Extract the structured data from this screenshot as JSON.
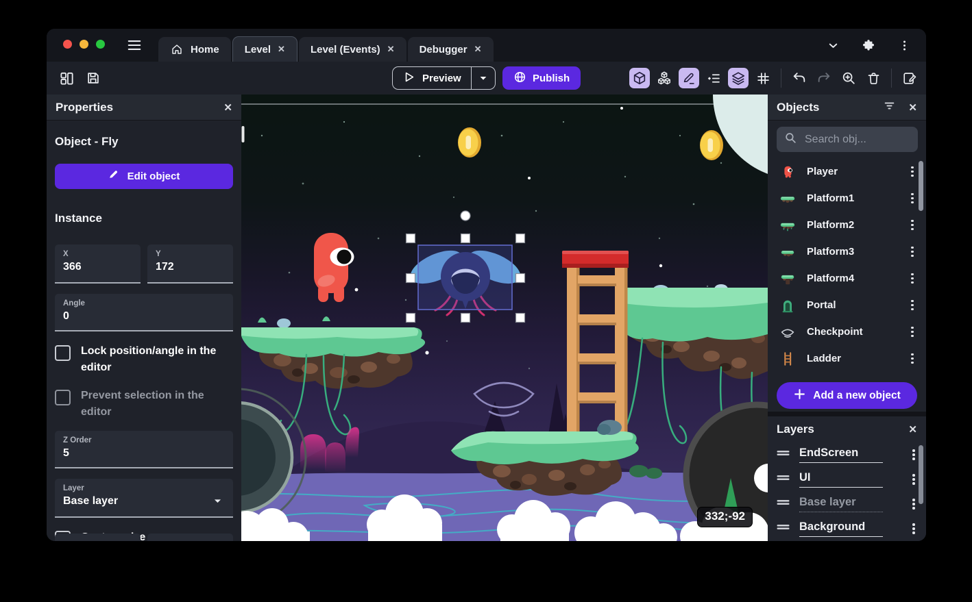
{
  "titlebar": {
    "tabs": [
      {
        "label": "Home",
        "closable": false,
        "active": false
      },
      {
        "label": "Level",
        "closable": true,
        "active": true
      },
      {
        "label": "Level (Events)",
        "closable": true,
        "active": false
      },
      {
        "label": "Debugger",
        "closable": true,
        "active": false
      }
    ]
  },
  "toolbar": {
    "preview_label": "Preview",
    "publish_label": "Publish"
  },
  "properties_panel": {
    "title": "Properties",
    "object_heading": "Object - Fly",
    "edit_object_label": "Edit object",
    "instance_heading": "Instance",
    "fields": {
      "x": {
        "label": "X",
        "value": "366"
      },
      "y": {
        "label": "Y",
        "value": "172"
      },
      "angle": {
        "label": "Angle",
        "value": "0"
      },
      "z_order": {
        "label": "Z Order",
        "value": "5"
      },
      "layer": {
        "label": "Layer",
        "value": "Base layer"
      }
    },
    "checkboxes": [
      {
        "label": "Lock position/angle in the editor",
        "checked": false
      },
      {
        "label": "Prevent selection in the editor",
        "checked": false
      },
      {
        "label": "Custom size",
        "checked": false
      }
    ]
  },
  "objects_panel": {
    "title": "Objects",
    "search_placeholder": "Search obj...",
    "items": [
      {
        "name": "Player",
        "icon": "player-icon"
      },
      {
        "name": "Platform1",
        "icon": "platform1-icon"
      },
      {
        "name": "Platform2",
        "icon": "platform2-icon"
      },
      {
        "name": "Platform3",
        "icon": "platform3-icon"
      },
      {
        "name": "Platform4",
        "icon": "platform4-icon"
      },
      {
        "name": "Portal",
        "icon": "portal-icon"
      },
      {
        "name": "Checkpoint",
        "icon": "checkpoint-icon"
      },
      {
        "name": "Ladder",
        "icon": "ladder-icon"
      }
    ],
    "add_button_label": "Add a new object"
  },
  "layers_panel": {
    "title": "Layers",
    "items": [
      {
        "name": "EndScreen",
        "muted": false
      },
      {
        "name": "UI",
        "muted": false
      },
      {
        "name": "Base layer",
        "muted": true
      },
      {
        "name": "Background",
        "muted": false
      }
    ]
  },
  "canvas": {
    "coordinate_badge": "332;-92"
  },
  "icons": {
    "close_glyph": "✕"
  },
  "colors": {
    "accent_purple": "#5b28e0",
    "active_tool_bg": "#c9b9f1",
    "selection_blue": "#6069c8",
    "canvas_sky_top": "#0b1512",
    "canvas_water": "#6f67b6"
  }
}
